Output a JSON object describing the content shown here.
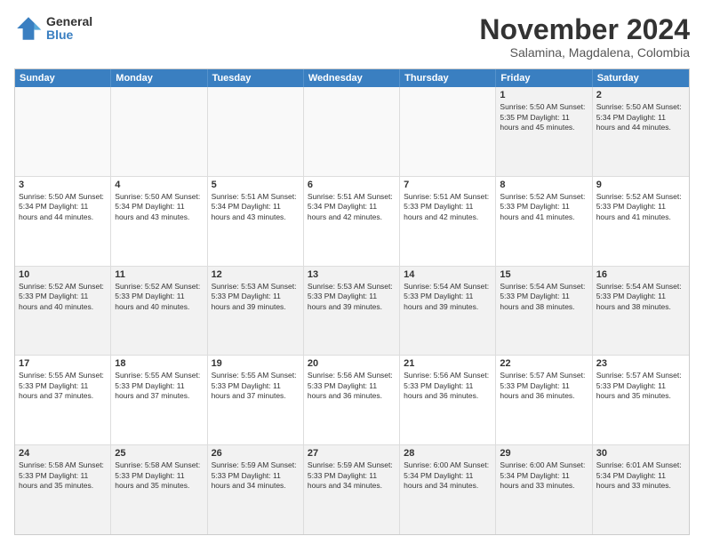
{
  "logo": {
    "general": "General",
    "blue": "Blue"
  },
  "header": {
    "month": "November 2024",
    "location": "Salamina, Magdalena, Colombia"
  },
  "weekdays": [
    "Sunday",
    "Monday",
    "Tuesday",
    "Wednesday",
    "Thursday",
    "Friday",
    "Saturday"
  ],
  "rows": [
    [
      {
        "day": "",
        "text": "",
        "empty": true
      },
      {
        "day": "",
        "text": "",
        "empty": true
      },
      {
        "day": "",
        "text": "",
        "empty": true
      },
      {
        "day": "",
        "text": "",
        "empty": true
      },
      {
        "day": "",
        "text": "",
        "empty": true
      },
      {
        "day": "1",
        "text": "Sunrise: 5:50 AM\nSunset: 5:35 PM\nDaylight: 11 hours\nand 45 minutes.",
        "empty": false
      },
      {
        "day": "2",
        "text": "Sunrise: 5:50 AM\nSunset: 5:34 PM\nDaylight: 11 hours\nand 44 minutes.",
        "empty": false
      }
    ],
    [
      {
        "day": "3",
        "text": "Sunrise: 5:50 AM\nSunset: 5:34 PM\nDaylight: 11 hours\nand 44 minutes.",
        "empty": false
      },
      {
        "day": "4",
        "text": "Sunrise: 5:50 AM\nSunset: 5:34 PM\nDaylight: 11 hours\nand 43 minutes.",
        "empty": false
      },
      {
        "day": "5",
        "text": "Sunrise: 5:51 AM\nSunset: 5:34 PM\nDaylight: 11 hours\nand 43 minutes.",
        "empty": false
      },
      {
        "day": "6",
        "text": "Sunrise: 5:51 AM\nSunset: 5:34 PM\nDaylight: 11 hours\nand 42 minutes.",
        "empty": false
      },
      {
        "day": "7",
        "text": "Sunrise: 5:51 AM\nSunset: 5:33 PM\nDaylight: 11 hours\nand 42 minutes.",
        "empty": false
      },
      {
        "day": "8",
        "text": "Sunrise: 5:52 AM\nSunset: 5:33 PM\nDaylight: 11 hours\nand 41 minutes.",
        "empty": false
      },
      {
        "day": "9",
        "text": "Sunrise: 5:52 AM\nSunset: 5:33 PM\nDaylight: 11 hours\nand 41 minutes.",
        "empty": false
      }
    ],
    [
      {
        "day": "10",
        "text": "Sunrise: 5:52 AM\nSunset: 5:33 PM\nDaylight: 11 hours\nand 40 minutes.",
        "empty": false
      },
      {
        "day": "11",
        "text": "Sunrise: 5:52 AM\nSunset: 5:33 PM\nDaylight: 11 hours\nand 40 minutes.",
        "empty": false
      },
      {
        "day": "12",
        "text": "Sunrise: 5:53 AM\nSunset: 5:33 PM\nDaylight: 11 hours\nand 39 minutes.",
        "empty": false
      },
      {
        "day": "13",
        "text": "Sunrise: 5:53 AM\nSunset: 5:33 PM\nDaylight: 11 hours\nand 39 minutes.",
        "empty": false
      },
      {
        "day": "14",
        "text": "Sunrise: 5:54 AM\nSunset: 5:33 PM\nDaylight: 11 hours\nand 39 minutes.",
        "empty": false
      },
      {
        "day": "15",
        "text": "Sunrise: 5:54 AM\nSunset: 5:33 PM\nDaylight: 11 hours\nand 38 minutes.",
        "empty": false
      },
      {
        "day": "16",
        "text": "Sunrise: 5:54 AM\nSunset: 5:33 PM\nDaylight: 11 hours\nand 38 minutes.",
        "empty": false
      }
    ],
    [
      {
        "day": "17",
        "text": "Sunrise: 5:55 AM\nSunset: 5:33 PM\nDaylight: 11 hours\nand 37 minutes.",
        "empty": false
      },
      {
        "day": "18",
        "text": "Sunrise: 5:55 AM\nSunset: 5:33 PM\nDaylight: 11 hours\nand 37 minutes.",
        "empty": false
      },
      {
        "day": "19",
        "text": "Sunrise: 5:55 AM\nSunset: 5:33 PM\nDaylight: 11 hours\nand 37 minutes.",
        "empty": false
      },
      {
        "day": "20",
        "text": "Sunrise: 5:56 AM\nSunset: 5:33 PM\nDaylight: 11 hours\nand 36 minutes.",
        "empty": false
      },
      {
        "day": "21",
        "text": "Sunrise: 5:56 AM\nSunset: 5:33 PM\nDaylight: 11 hours\nand 36 minutes.",
        "empty": false
      },
      {
        "day": "22",
        "text": "Sunrise: 5:57 AM\nSunset: 5:33 PM\nDaylight: 11 hours\nand 36 minutes.",
        "empty": false
      },
      {
        "day": "23",
        "text": "Sunrise: 5:57 AM\nSunset: 5:33 PM\nDaylight: 11 hours\nand 35 minutes.",
        "empty": false
      }
    ],
    [
      {
        "day": "24",
        "text": "Sunrise: 5:58 AM\nSunset: 5:33 PM\nDaylight: 11 hours\nand 35 minutes.",
        "empty": false
      },
      {
        "day": "25",
        "text": "Sunrise: 5:58 AM\nSunset: 5:33 PM\nDaylight: 11 hours\nand 35 minutes.",
        "empty": false
      },
      {
        "day": "26",
        "text": "Sunrise: 5:59 AM\nSunset: 5:33 PM\nDaylight: 11 hours\nand 34 minutes.",
        "empty": false
      },
      {
        "day": "27",
        "text": "Sunrise: 5:59 AM\nSunset: 5:33 PM\nDaylight: 11 hours\nand 34 minutes.",
        "empty": false
      },
      {
        "day": "28",
        "text": "Sunrise: 6:00 AM\nSunset: 5:34 PM\nDaylight: 11 hours\nand 34 minutes.",
        "empty": false
      },
      {
        "day": "29",
        "text": "Sunrise: 6:00 AM\nSunset: 5:34 PM\nDaylight: 11 hours\nand 33 minutes.",
        "empty": false
      },
      {
        "day": "30",
        "text": "Sunrise: 6:01 AM\nSunset: 5:34 PM\nDaylight: 11 hours\nand 33 minutes.",
        "empty": false
      }
    ]
  ]
}
